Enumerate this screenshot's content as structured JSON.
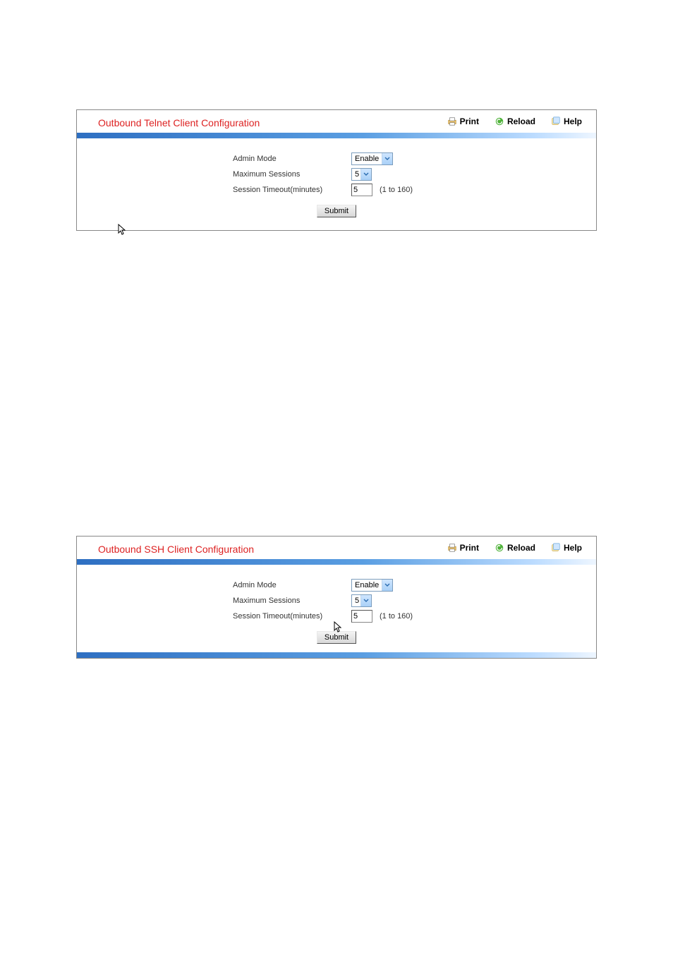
{
  "actions": {
    "print": "Print",
    "reload": "Reload",
    "help": "Help"
  },
  "panel1": {
    "title": "Outbound Telnet Client Configuration",
    "fields": {
      "admin_mode_label": "Admin Mode",
      "admin_mode_value": "Enable",
      "max_sessions_label": "Maximum Sessions",
      "max_sessions_value": "5",
      "session_timeout_label": "Session Timeout(minutes)",
      "session_timeout_value": "5",
      "session_timeout_hint": "(1 to 160)"
    },
    "submit_label": "Submit"
  },
  "panel2": {
    "title": "Outbound SSH Client Configuration",
    "fields": {
      "admin_mode_label": "Admin Mode",
      "admin_mode_value": "Enable",
      "max_sessions_label": "Maximum Sessions",
      "max_sessions_value": "5",
      "session_timeout_label": "Session Timeout(minutes)",
      "session_timeout_value": "5",
      "session_timeout_hint": "(1 to 160)"
    },
    "submit_label": "Submit"
  }
}
